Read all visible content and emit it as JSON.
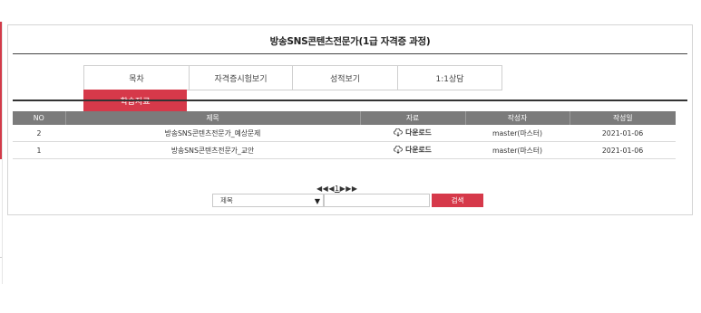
{
  "page": {
    "title": "방송SNS콘텐츠전문가(1급 자격증 과정)"
  },
  "tabs": [
    {
      "label": "목차"
    },
    {
      "label": "자격증시험보기"
    },
    {
      "label": "성적보기"
    },
    {
      "label": "1:1상담"
    },
    {
      "label": "학습자료"
    }
  ],
  "table": {
    "headers": [
      "NO",
      "제목",
      "자료",
      "작성자",
      "작성일"
    ],
    "rows": [
      {
        "no": "2",
        "title": "방송SNS콘텐츠전문가_예상문제",
        "file": "다운로드",
        "author": "master(마스터)",
        "date": "2021-01-06"
      },
      {
        "no": "1",
        "title": "방송SNS콘텐츠전문가_교안",
        "file": "다운로드",
        "author": "master(마스터)",
        "date": "2021-01-06"
      }
    ]
  },
  "pager": {
    "first": "◀◀",
    "prev": "◀",
    "current": "1",
    "next": "▶",
    "last": "▶▶"
  },
  "search": {
    "select_value": "제목",
    "input_value": "",
    "button_label": "검색"
  },
  "colors": {
    "accent": "#d6394a",
    "header_bg": "#7b7b7b"
  }
}
